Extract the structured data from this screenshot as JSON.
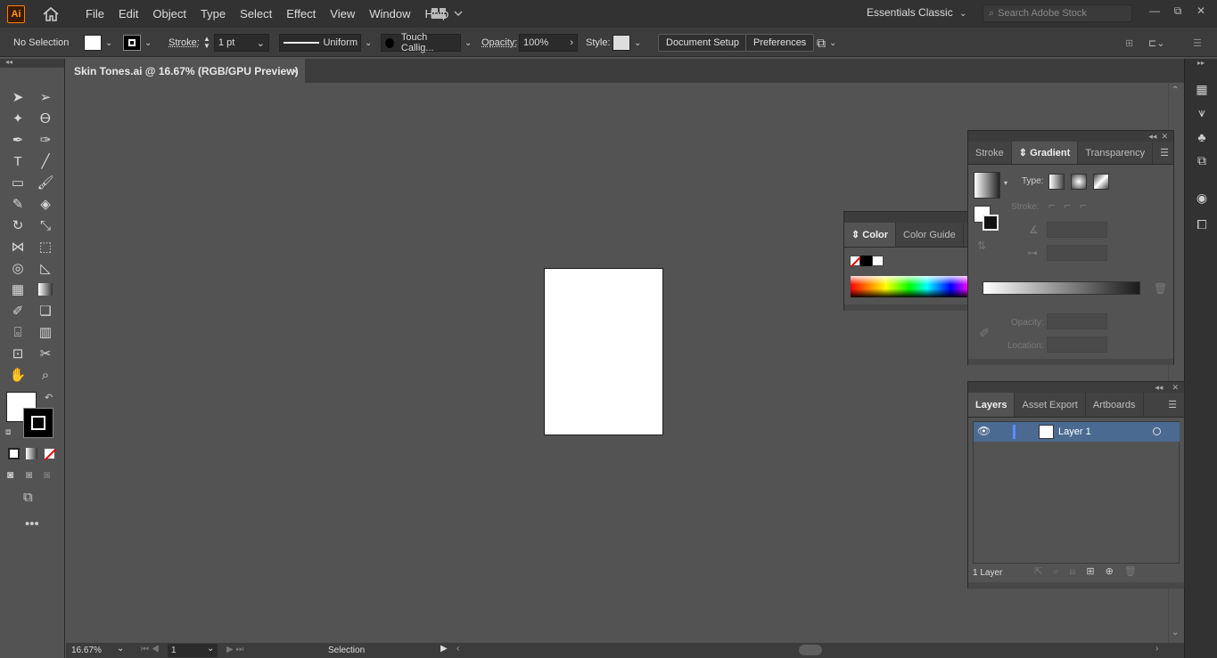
{
  "app": {
    "logo": "Ai",
    "workspace": "Essentials Classic",
    "search_placeholder": "Search Adobe Stock"
  },
  "menu": [
    "File",
    "Edit",
    "Object",
    "Type",
    "Select",
    "Effect",
    "View",
    "Window",
    "Help"
  ],
  "control": {
    "selection": "No Selection",
    "stroke_label": "Stroke:",
    "stroke_weight": "1 pt",
    "profile": "Uniform",
    "brush": "Touch Callig...",
    "opacity_label": "Opacity:",
    "opacity": "100%",
    "style_label": "Style:",
    "document_setup": "Document Setup",
    "preferences": "Preferences"
  },
  "document": {
    "tab_title": "Skin Tones.ai @ 16.67% (RGB/GPU Preview)",
    "close": "×"
  },
  "status": {
    "zoom": "16.67%",
    "artboard": "1",
    "tool": "Selection"
  },
  "color_panel": {
    "tabs": [
      "Color",
      "Color Guide"
    ]
  },
  "gradient_panel": {
    "tabs": [
      "Stroke",
      "Gradient",
      "Transparency"
    ],
    "type_label": "Type:",
    "stroke_label": "Stroke:",
    "opacity_label": "Opacity:",
    "location_label": "Location:"
  },
  "layers_panel": {
    "tabs": [
      "Layers",
      "Asset Export",
      "Artboards"
    ],
    "layer_name": "Layer 1",
    "count": "1 Layer"
  },
  "colors": {
    "accent": "#ff7c00",
    "layer_highlight": "#4b6a92",
    "artboard": "#ffffff"
  }
}
